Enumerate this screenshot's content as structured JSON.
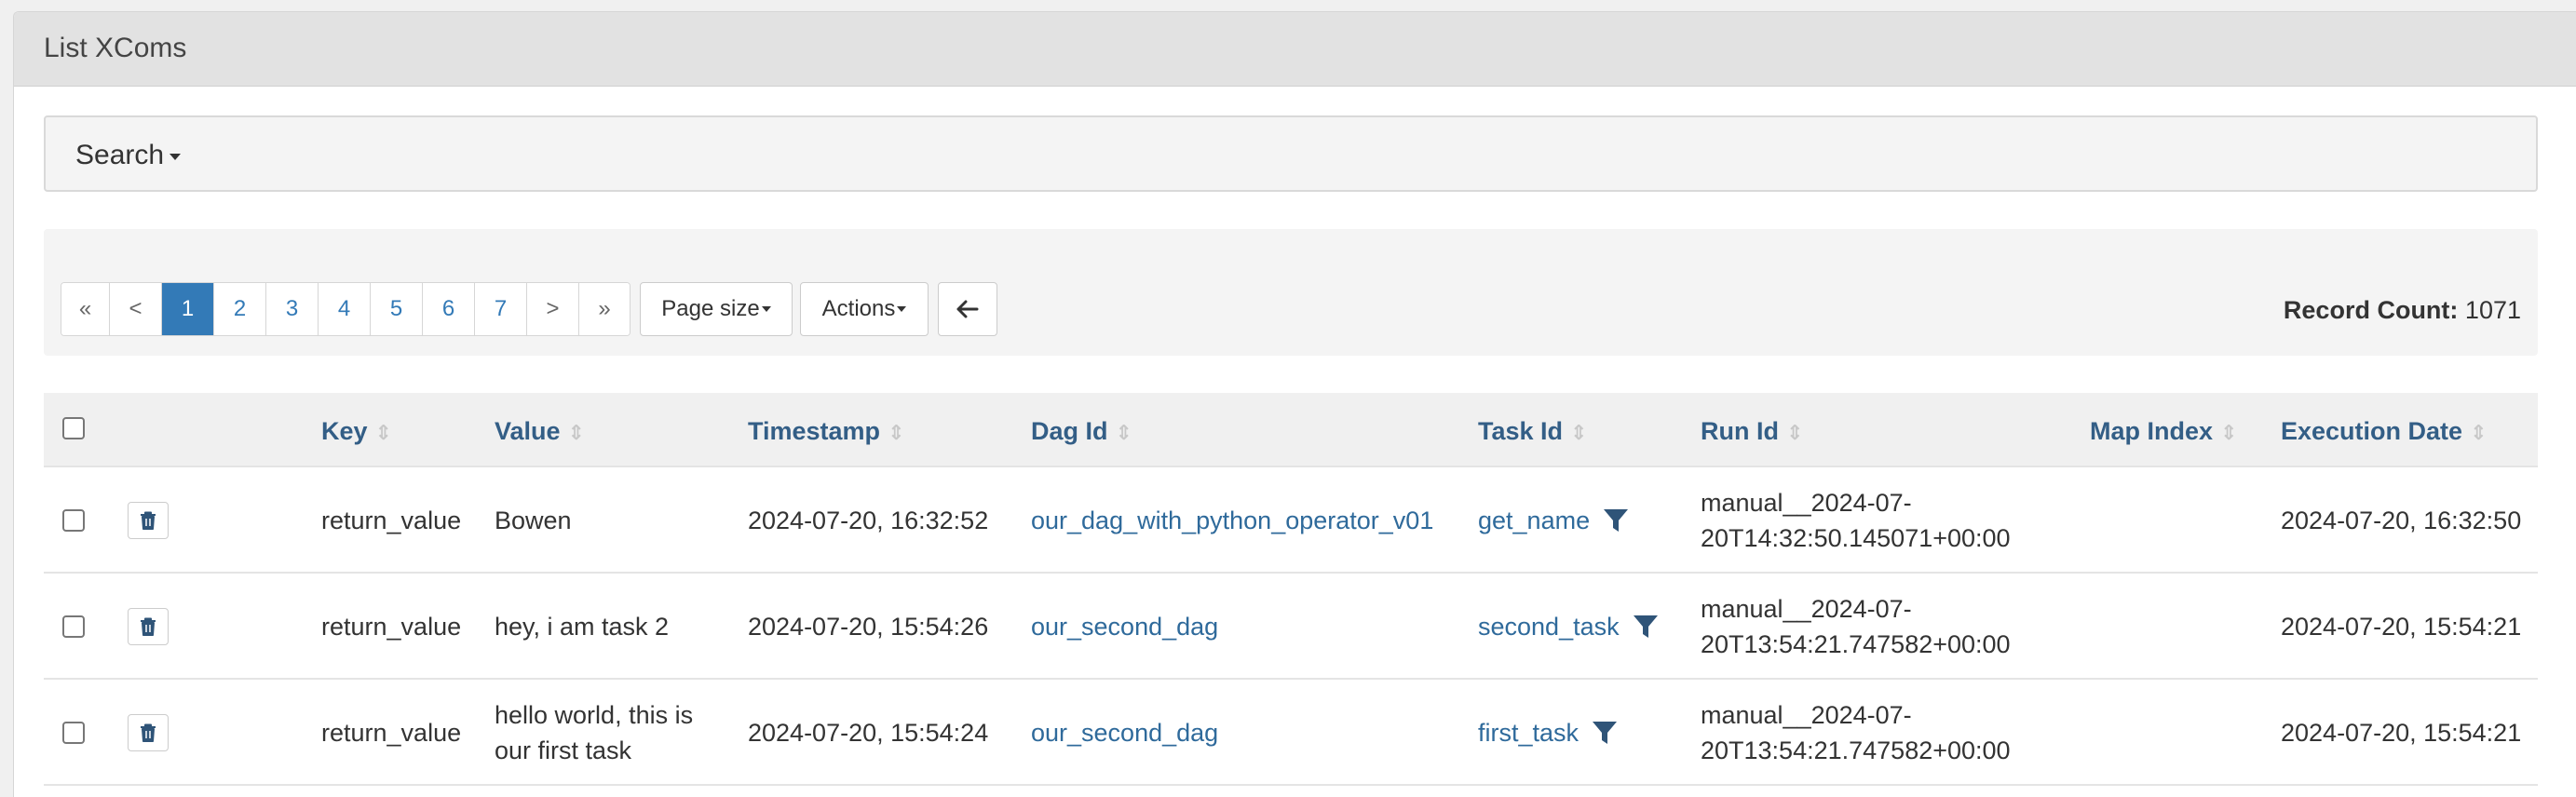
{
  "header": {
    "title": "List XComs"
  },
  "search": {
    "label": "Search"
  },
  "pagination": {
    "items": [
      "«",
      "<",
      "1",
      "2",
      "3",
      "4",
      "5",
      "6",
      "7",
      ">",
      "»"
    ],
    "active": "1"
  },
  "toolbar": {
    "page_size_label": "Page size",
    "actions_label": "Actions",
    "record_count_label": "Record Count:",
    "record_count_value": "1071"
  },
  "table": {
    "columns": [
      "Key",
      "Value",
      "Timestamp",
      "Dag Id",
      "Task Id",
      "Run Id",
      "Map Index",
      "Execution Date"
    ],
    "rows": [
      {
        "key": "return_value",
        "value": "Bowen",
        "timestamp": "2024-07-20, 16:32:52",
        "dag_id": "our_dag_with_python_operator_v01",
        "task_id": "get_name",
        "run_id_1": "manual__2024-07-",
        "run_id_2": "20T14:32:50.145071+00:00",
        "map_index": "",
        "execution_date": "2024-07-20, 16:32:50"
      },
      {
        "key": "return_value",
        "value": "hey, i am task 2",
        "timestamp": "2024-07-20, 15:54:26",
        "dag_id": "our_second_dag",
        "task_id": "second_task",
        "run_id_1": "manual__2024-07-",
        "run_id_2": "20T13:54:21.747582+00:00",
        "map_index": "",
        "execution_date": "2024-07-20, 15:54:21"
      },
      {
        "key": "return_value",
        "value_1": "hello world, this is",
        "value_2": "our first task",
        "timestamp": "2024-07-20, 15:54:24",
        "dag_id": "our_second_dag",
        "task_id": "first_task",
        "run_id_1": "manual__2024-07-",
        "run_id_2": "20T13:54:21.747582+00:00",
        "map_index": "",
        "execution_date": "2024-07-20, 15:54:21"
      }
    ]
  },
  "colors": {
    "accent": "#337ab7",
    "header_link": "#335e86",
    "link": "#2f6a9b",
    "icon": "#2f5478"
  },
  "icons": [
    "caret-down-icon",
    "arrow-left-icon",
    "sort-icon",
    "trash-icon",
    "filter-icon"
  ]
}
